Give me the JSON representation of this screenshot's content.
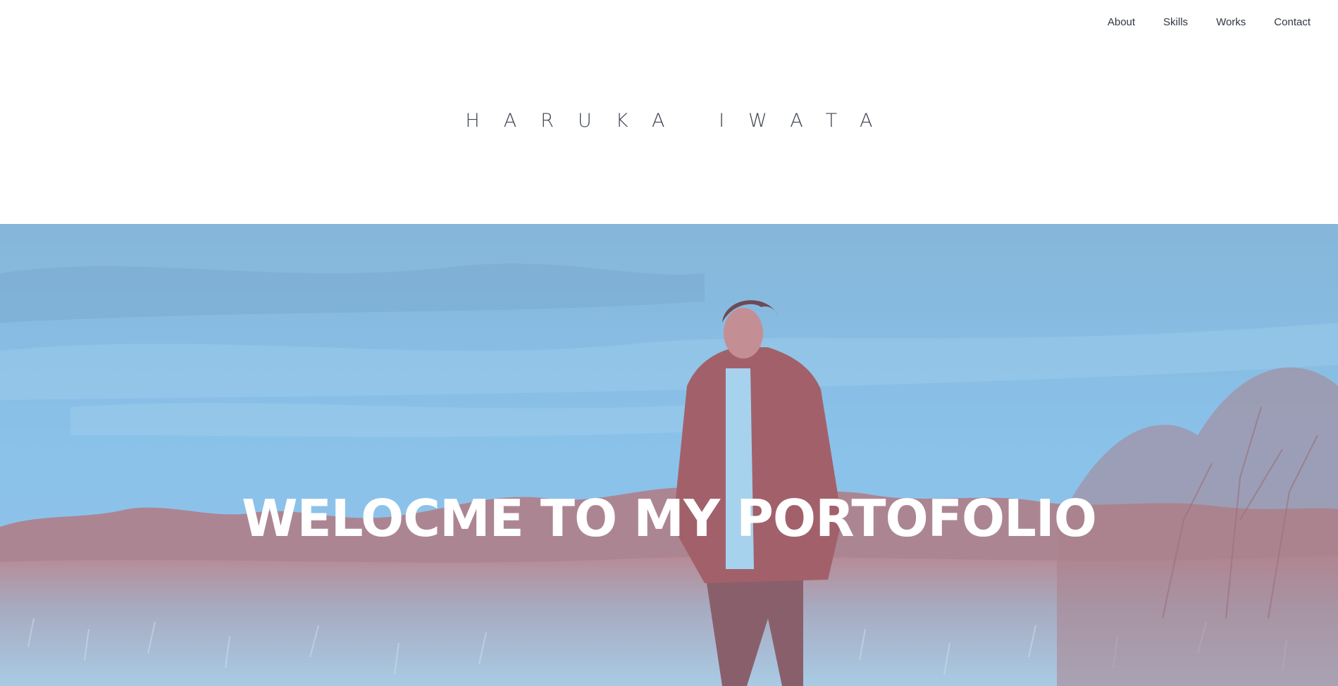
{
  "nav": {
    "items": [
      {
        "label": "About"
      },
      {
        "label": "Skills"
      },
      {
        "label": "Works"
      },
      {
        "label": "Contact"
      }
    ]
  },
  "header": {
    "site_title": "HARUKA IWATA"
  },
  "hero": {
    "heading": "WELOCME TO MY PORTOFOLIO",
    "image_description_colors": {
      "sky": "#8cc0e6",
      "overlay_tint": "#c0737a",
      "heading_color": "#ffffff"
    }
  }
}
